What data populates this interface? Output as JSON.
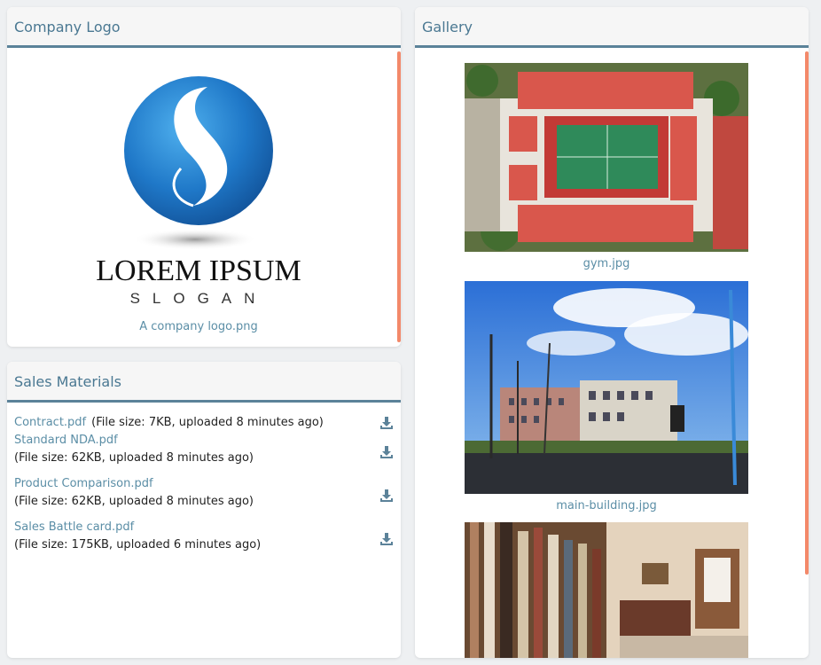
{
  "company_logo": {
    "title": "Company Logo",
    "brand_name": "LOREM IPSUM",
    "slogan": "SLOGAN",
    "caption": "A company logo.png"
  },
  "sales_materials": {
    "title": "Sales Materials",
    "files": [
      {
        "name": "Contract.pdf",
        "meta": "(File size: 7KB, uploaded 8 minutes ago)"
      },
      {
        "name": "Standard NDA.pdf",
        "meta": "(File size: 62KB, uploaded 8 minutes ago)"
      },
      {
        "name": "Product Comparison.pdf",
        "meta": "(File size: 62KB, uploaded 8 minutes ago)"
      },
      {
        "name": "Sales Battle card.pdf",
        "meta": "(File size: 175KB, uploaded 6 minutes ago)"
      }
    ],
    "download_icon": "download-icon"
  },
  "gallery": {
    "title": "Gallery",
    "images": [
      {
        "caption": "gym.jpg"
      },
      {
        "caption": "main-building.jpg"
      },
      {
        "caption": ""
      }
    ]
  },
  "colors": {
    "header_text": "#4a7892",
    "header_border": "#5b8299",
    "link": "#5b8ea6",
    "scroll_accent": "#f3896a",
    "logo_blue": "#1f78c8"
  }
}
